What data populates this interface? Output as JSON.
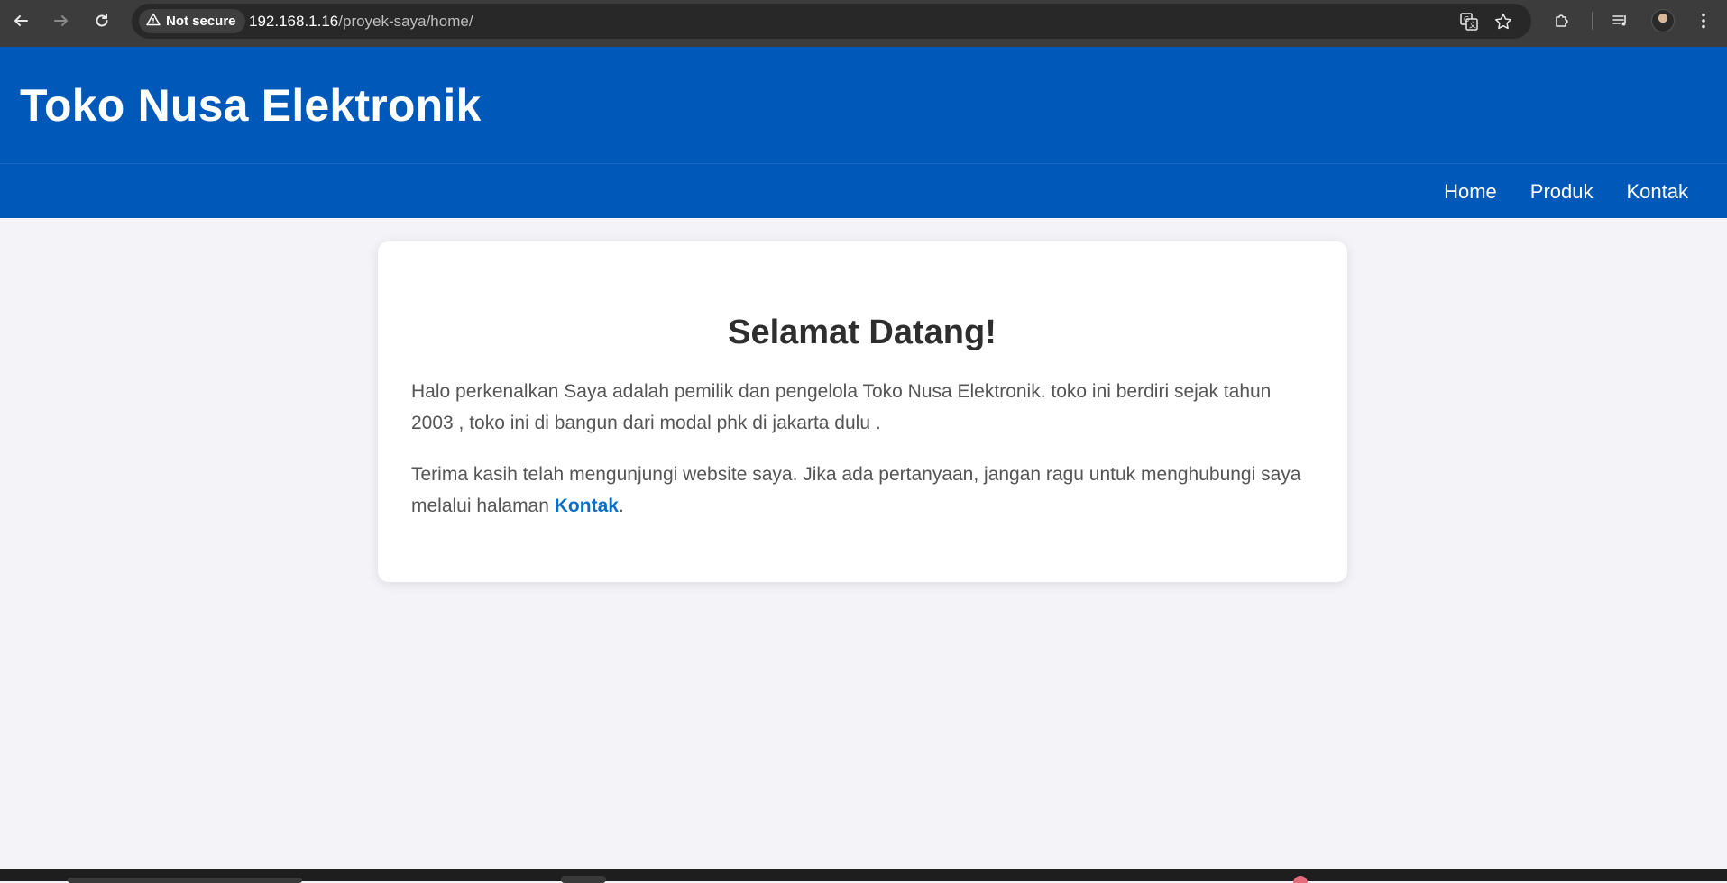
{
  "browser": {
    "security_label": "Not secure",
    "url_host": "192.168.1.16",
    "url_path": "/proyek-saya/home/",
    "icons": {
      "back": "back-arrow-icon",
      "forward": "forward-arrow-icon",
      "reload": "reload-icon",
      "warning": "warning-triangle-icon",
      "translate": "translate-icon",
      "bookmark": "star-icon",
      "extensions": "puzzle-icon",
      "media": "media-queue-icon",
      "profile": "avatar",
      "menu": "kebab-menu-icon"
    }
  },
  "header": {
    "title": "Toko Nusa Elektronik",
    "background": "#0058b8",
    "nav": [
      {
        "label": "Home"
      },
      {
        "label": "Produk"
      },
      {
        "label": "Kontak"
      }
    ]
  },
  "main": {
    "heading": "Selamat Datang!",
    "paragraph1": "Halo perkenalkan Saya adalah pemilik dan pengelola Toko Nusa Elektronik. toko ini berdiri sejak tahun 2003 , toko ini di bangun dari modal phk di jakarta dulu .",
    "paragraph2_prefix": "Terima kasih telah mengunjungi website saya. Jika ada pertanyaan, jangan ragu untuk menghubungi saya melalui halaman ",
    "paragraph2_link": "Kontak",
    "paragraph2_suffix": ".",
    "link_color": "#0a6fc4"
  }
}
